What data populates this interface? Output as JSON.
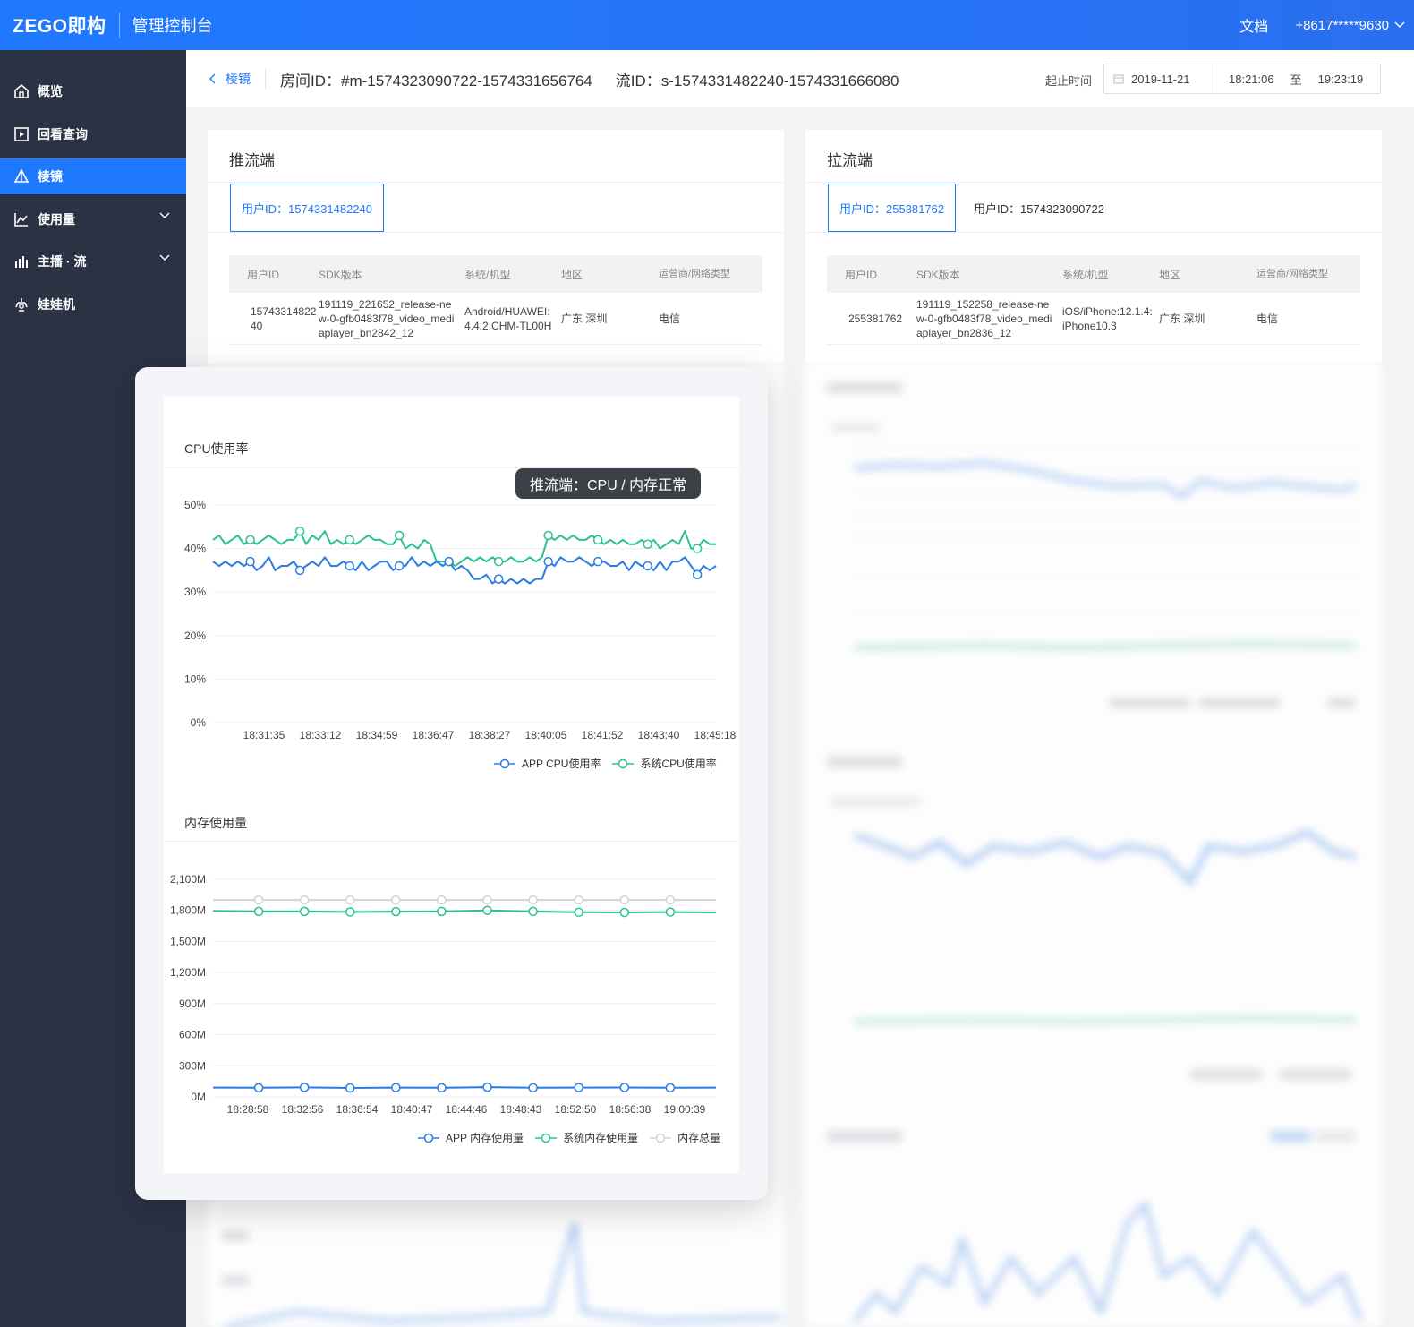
{
  "topbar": {
    "logo": "ZEGO即构",
    "console_title": "管理控制台",
    "docs": "文档",
    "account": "+8617*****9630"
  },
  "sidebar": {
    "items": [
      {
        "label": "概览",
        "icon": "home-icon"
      },
      {
        "label": "回看查询",
        "icon": "playback-icon"
      },
      {
        "label": "棱镜",
        "icon": "prism-icon",
        "active": true
      },
      {
        "label": "使用量",
        "icon": "usage-chart-icon",
        "expandable": true
      },
      {
        "label": "主播 · 流",
        "icon": "bar-chart-icon",
        "expandable": true
      },
      {
        "label": "娃娃机",
        "icon": "claw-machine-icon"
      }
    ]
  },
  "header": {
    "back_label": "棱镜",
    "room_id": "房间ID：#m-1574323090722-1574331656764",
    "stream_id": "流ID：s-1574331482240-1574331666080",
    "time_label": "起止时间",
    "date": "2019-11-21",
    "start_time": "18:21:06",
    "to": "至",
    "end_time": "19:23:19"
  },
  "push_card": {
    "title": "推流端",
    "tabs": [
      "用户ID：1574331482240"
    ],
    "columns": [
      "用户ID",
      "SDK版本",
      "系统/机型",
      "地区",
      "运营商/网络类型"
    ],
    "row": [
      "1574331482240",
      "191119_221652_release-new-0-gfb0483f78_video_mediaplayer_bn2842_12",
      "Android/HUAWEI:4.4.2:CHM-TL00H",
      "广东 深圳",
      "电信"
    ]
  },
  "pull_card": {
    "title": "拉流端",
    "tabs": [
      "用户ID：255381762",
      "用户ID：1574323090722"
    ],
    "columns": [
      "用户ID",
      "SDK版本",
      "系统/机型",
      "地区",
      "运营商/网络类型"
    ],
    "row": [
      "255381762",
      "191119_152258_release-new-0-gfb0483f78_video_mediaplayer_bn2836_12",
      "iOS/iPhone:12.1.4:iPhone10.3",
      "广东 深圳",
      "电信"
    ]
  },
  "overlay": {
    "tooltip": "推流端：CPU / 内存正常",
    "cpu_title": "CPU使用率",
    "mem_title": "内存使用量"
  },
  "colors": {
    "brand_blue": "#1f79ff",
    "app_series": "#2a7be4",
    "system_series": "#2bc38b",
    "total_series": "#cfd3da",
    "sidebar_bg": "#2b3244"
  },
  "chart_data": [
    {
      "type": "line",
      "title": "CPU使用率",
      "y_ticks": [
        "50%",
        "40%",
        "30%",
        "20%",
        "10%",
        "0%"
      ],
      "ylim": [
        0,
        50
      ],
      "x_ticks": [
        "18:31:35",
        "18:33:12",
        "18:34:59",
        "18:36:47",
        "18:38:27",
        "18:40:05",
        "18:41:52",
        "18:43:40",
        "18:45:18"
      ],
      "series": [
        {
          "name": "APP CPU使用率",
          "color": "#2a7be4",
          "values": [
            37,
            36,
            37,
            36,
            37,
            36,
            37,
            35,
            36,
            38,
            35,
            36,
            36,
            37,
            35,
            36,
            37,
            36,
            38,
            36,
            36,
            37,
            36,
            35,
            37,
            35,
            36,
            37,
            37,
            35,
            36,
            36,
            38,
            36,
            37,
            36,
            37,
            36,
            37,
            35,
            36,
            35,
            33,
            33,
            34,
            32,
            33,
            32,
            33,
            32,
            33,
            32,
            33,
            33,
            37,
            36,
            38,
            37,
            37,
            38,
            37,
            36,
            37,
            37,
            36,
            36,
            37,
            35,
            37,
            36,
            36,
            35,
            37,
            35,
            37,
            37,
            38,
            36,
            34,
            36,
            35,
            36
          ]
        },
        {
          "name": "系统CPU使用率",
          "color": "#2bc38b",
          "values": [
            42,
            43,
            41,
            42,
            43,
            41,
            42,
            41,
            42,
            43,
            42,
            41,
            42,
            42,
            44,
            41,
            43,
            42,
            44,
            41,
            42,
            41,
            42,
            41,
            42,
            43,
            42,
            42,
            41,
            41,
            43,
            40,
            41,
            40,
            42,
            41,
            37,
            37,
            37,
            36,
            37,
            38,
            37,
            38,
            37,
            38,
            37,
            37,
            38,
            37,
            37,
            38,
            37,
            38,
            43,
            42,
            43,
            42,
            43,
            42,
            42,
            43,
            42,
            41,
            42,
            41,
            42,
            41,
            41,
            42,
            41,
            42,
            40,
            41,
            42,
            41,
            44,
            40,
            40,
            42,
            41,
            41
          ]
        }
      ]
    },
    {
      "type": "line",
      "title": "内存使用量",
      "y_ticks": [
        "2,100M",
        "1,800M",
        "1,500M",
        "1,200M",
        "900M",
        "600M",
        "300M",
        "0M"
      ],
      "ylim": [
        0,
        2100
      ],
      "x_ticks": [
        "18:28:58",
        "18:32:56",
        "18:36:54",
        "18:40:47",
        "18:44:46",
        "18:48:43",
        "18:52:50",
        "18:56:38",
        "19:00:39"
      ],
      "series": [
        {
          "name": "APP 内存使用量",
          "color": "#2a7be4",
          "values": [
            90,
            88,
            92,
            86,
            90,
            88,
            94,
            88,
            90,
            91,
            88,
            90
          ]
        },
        {
          "name": "系统内存使用量",
          "color": "#2bc38b",
          "values": [
            1795,
            1790,
            1790,
            1785,
            1788,
            1790,
            1800,
            1790,
            1782,
            1780,
            1784,
            1780
          ]
        },
        {
          "name": "内存总量",
          "color": "#cfd3da",
          "values": [
            1900,
            1900,
            1900,
            1900,
            1900,
            1900,
            1900,
            1900,
            1900,
            1900,
            1900,
            1900
          ]
        }
      ]
    }
  ]
}
